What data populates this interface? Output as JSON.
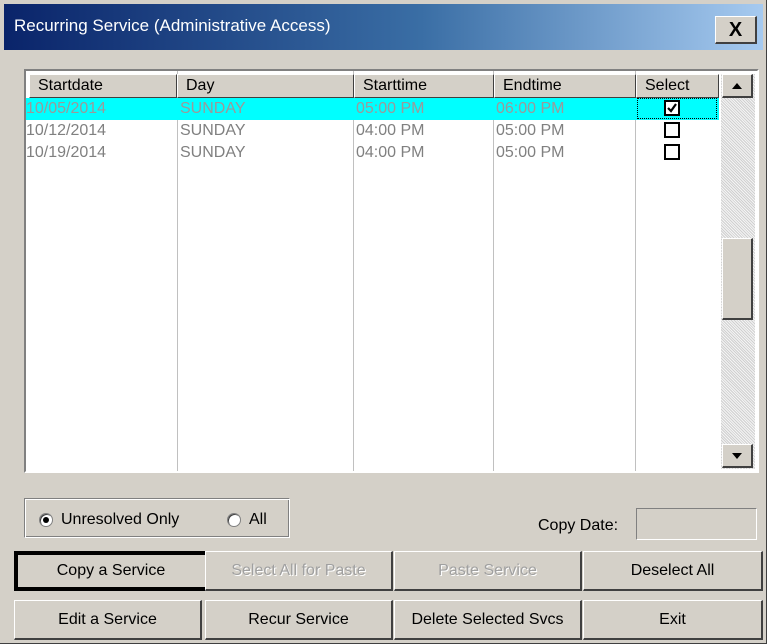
{
  "window": {
    "title": "Recurring Service (Administrative Access)",
    "close_label": "X"
  },
  "table": {
    "columns": [
      "Startdate",
      "Day",
      "Starttime",
      "Endtime",
      "Select"
    ],
    "rows": [
      {
        "startdate": "10/05/2014",
        "day": "SUNDAY",
        "starttime": "05:00 PM",
        "endtime": "06:00 PM",
        "selected": true,
        "checked": true
      },
      {
        "startdate": "10/12/2014",
        "day": "SUNDAY",
        "starttime": "04:00 PM",
        "endtime": "05:00 PM",
        "selected": false,
        "checked": false
      },
      {
        "startdate": "10/19/2014",
        "day": "SUNDAY",
        "starttime": "04:00 PM",
        "endtime": "05:00 PM",
        "selected": false,
        "checked": false
      }
    ],
    "selected_row_color": "#00ffff"
  },
  "filter": {
    "option_unresolved": "Unresolved Only",
    "option_all": "All",
    "selected": "Unresolved Only"
  },
  "copy_date": {
    "label": "Copy Date:",
    "value": ""
  },
  "buttons": {
    "copy_service": "Copy a Service",
    "select_all_paste": "Select All  for Paste",
    "paste_service": "Paste Service",
    "deselect_all": "Deselect All",
    "edit_service": "Edit a Service",
    "recur_service": "Recur Service",
    "delete_selected": "Delete Selected Svcs",
    "exit": "Exit"
  },
  "colors": {
    "title_start": "#0a246a",
    "title_end": "#a6caf0",
    "face": "#d4d0c8"
  }
}
